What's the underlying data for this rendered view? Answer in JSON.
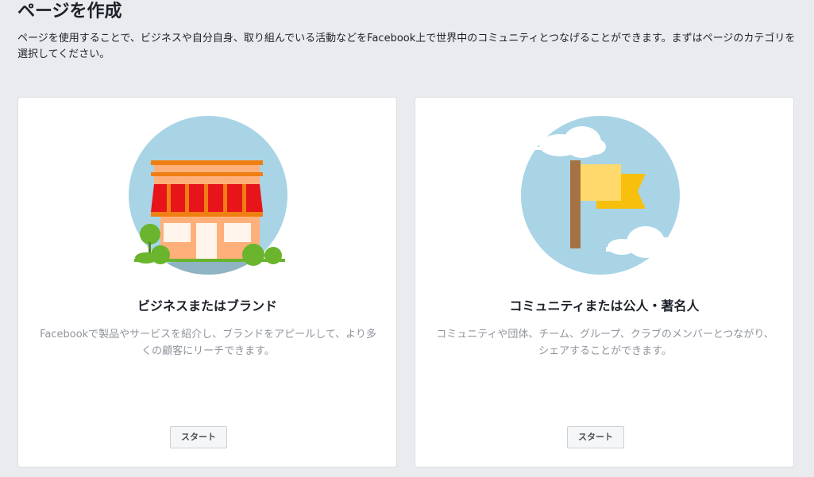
{
  "header": {
    "title": "ページを作成",
    "description": "ページを使用することで、ビジネスや自分自身、取り組んでいる活動などをFacebook上で世界中のコミュニティとつなげることができます。まずはページのカテゴリを選択してください。"
  },
  "cards": [
    {
      "title": "ビジネスまたはブランド",
      "description": "Facebookで製品やサービスを紹介し、ブランドをアピールして、より多くの顧客にリーチできます。",
      "button_label": "スタート",
      "illustration": "storefront-icon"
    },
    {
      "title": "コミュニティまたは公人・著名人",
      "description": "コミュニティや団体、チーム、グループ、クラブのメンバーとつながり、シェアすることができます。",
      "button_label": "スタート",
      "illustration": "flag-icon"
    }
  ],
  "colors": {
    "background": "#e9ebee",
    "card": "#ffffff",
    "sky": "#a8d4e6",
    "awning_red": "#e7141a",
    "roof_orange": "#f07f13",
    "wall_peach": "#ffb07a",
    "bush_green": "#6ab42e",
    "flag_yellow": "#ffd96b",
    "flag_gold": "#f7c00c",
    "pole_brown": "#a57243"
  }
}
